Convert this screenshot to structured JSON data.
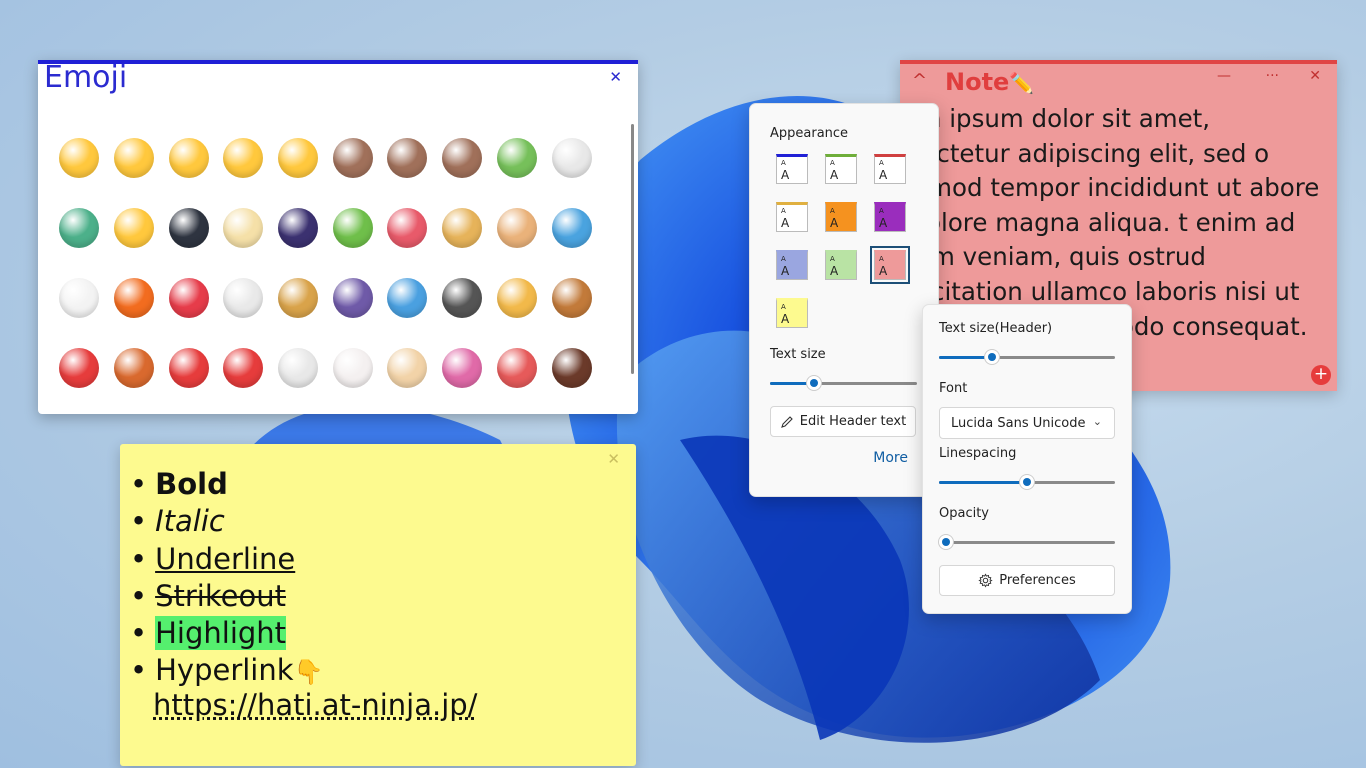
{
  "emoji_window": {
    "title": "Emoji",
    "close_glyph": "✕",
    "emojis": [
      {
        "name": "grinning-face-icon",
        "color": "#ffc83d"
      },
      {
        "name": "beaming-face-icon",
        "color": "#ffc83d"
      },
      {
        "name": "smiling-face-icon",
        "color": "#ffc83d"
      },
      {
        "name": "smiling-hearts-icon",
        "color": "#ffc83d"
      },
      {
        "name": "star-struck-icon",
        "color": "#ffc83d"
      },
      {
        "name": "see-no-evil-monkey-icon",
        "color": "#a0705a"
      },
      {
        "name": "hear-no-evil-monkey-icon",
        "color": "#a0705a"
      },
      {
        "name": "speak-no-evil-monkey-icon",
        "color": "#a0705a"
      },
      {
        "name": "frog-icon",
        "color": "#76c05a"
      },
      {
        "name": "rooster-icon",
        "color": "#e8e8e8"
      },
      {
        "name": "dragon-icon",
        "color": "#4cb08a"
      },
      {
        "name": "chick-icon",
        "color": "#ffc83d"
      },
      {
        "name": "penguin-icon",
        "color": "#2e3440"
      },
      {
        "name": "hatching-chick-icon",
        "color": "#f5e0a8"
      },
      {
        "name": "fireworks-icon",
        "color": "#3b3170"
      },
      {
        "name": "tanabata-tree-icon",
        "color": "#6fbf4a"
      },
      {
        "name": "carp-streamer-icon",
        "color": "#e85a6a"
      },
      {
        "name": "ferris-wheel-icon",
        "color": "#e6b35a"
      },
      {
        "name": "artist-palette-icon",
        "color": "#eab27a"
      },
      {
        "name": "kimono-icon",
        "color": "#4aa3df"
      },
      {
        "name": "baseball-icon",
        "color": "#f3f3f3"
      },
      {
        "name": "basketball-icon",
        "color": "#f26c1f"
      },
      {
        "name": "direct-hit-icon",
        "color": "#e63c4a"
      },
      {
        "name": "martial-arts-uniform-icon",
        "color": "#e9e9e9"
      },
      {
        "name": "pinata-icon",
        "color": "#d9a34a"
      },
      {
        "name": "musical-notes-icon",
        "color": "#6f5aa8"
      },
      {
        "name": "magnifying-glass-icon",
        "color": "#4aa0e0"
      },
      {
        "name": "fountain-pen-icon",
        "color": "#555555"
      },
      {
        "name": "pizza-icon",
        "color": "#f2b94a"
      },
      {
        "name": "hamburger-icon",
        "color": "#c27a3a"
      },
      {
        "name": "french-fries-icon",
        "color": "#e63c3c"
      },
      {
        "name": "hot-dog-icon",
        "color": "#d9692e"
      },
      {
        "name": "popcorn-icon",
        "color": "#e63c3c"
      },
      {
        "name": "ramen-icon",
        "color": "#e63c3c"
      },
      {
        "name": "rice-ball-icon",
        "color": "#e8e8e8"
      },
      {
        "name": "fish-cake-icon",
        "color": "#f4f0f0"
      },
      {
        "name": "birthday-cake-icon",
        "color": "#f2d3a8"
      },
      {
        "name": "lollipop-icon",
        "color": "#e06aa8"
      },
      {
        "name": "candy-icon",
        "color": "#e65a5a"
      },
      {
        "name": "chocolate-bar-icon",
        "color": "#6b3a2a"
      }
    ]
  },
  "yellow_note": {
    "close_glyph": "✕",
    "items": [
      "Bold",
      "Italic",
      "Underline",
      "Strikeout",
      "Highlight",
      "Hyperlink"
    ],
    "link": "https://hati.at-ninja.jp/",
    "pointing_emoji": "👇"
  },
  "red_note": {
    "title": "Note",
    "title_emoji": "✏️",
    "chevron": "^",
    "minimize": "—",
    "more": "···",
    "close": "✕",
    "text": "orem ipsum dolor sit amet, onsectetur adipiscing elit, sed o eiusmod tempor incididunt ut abore et dolore magna aliqua. t enim ad minim veniam, quis ostrud exercitation ullamco laboris nisi ut aliquip ex ea commodo consequat. Duis aute irure dolor",
    "add_glyph": "+"
  },
  "appearance_flyout": {
    "heading": "Appearance",
    "swatch_glyph_small": "A",
    "swatch_glyph_large": "A",
    "swatches": [
      {
        "bg": "#ffffff",
        "bar": "#2020d6"
      },
      {
        "bg": "#ffffff",
        "bar": "#6fae3a"
      },
      {
        "bg": "#ffffff",
        "bar": "#d04040"
      },
      {
        "bg": "#ffffff",
        "bar": "#e0b040"
      },
      {
        "bg": "#f5921f",
        "bar": "#f5921f"
      },
      {
        "bg": "#9a2dbd",
        "bar": "#9a2dbd"
      },
      {
        "bg": "#9aa6e0",
        "bar": "#9aa6e0"
      },
      {
        "bg": "#b9e3a4",
        "bar": "#b9e3a4"
      },
      {
        "bg": "#ee9a9a",
        "bar": "#ee9a9a"
      },
      {
        "bg": "#fdfa8f",
        "bar": "#fdfa8f"
      }
    ],
    "selected_swatch": 8,
    "text_size_label": "Text size",
    "text_size_value": 0.3,
    "edit_header_label": "Edit Header text",
    "more_label": "More",
    "accent": "#0f6cbd"
  },
  "more_flyout": {
    "header_size_label": "Text size(Header)",
    "header_size_value": 0.3,
    "font_label": "Font",
    "font_value": "Lucida Sans Unicode",
    "linespacing_label": "Linespacing",
    "linespacing_value": 0.5,
    "opacity_label": "Opacity",
    "opacity_value": 0.0,
    "preferences_label": "Preferences"
  }
}
